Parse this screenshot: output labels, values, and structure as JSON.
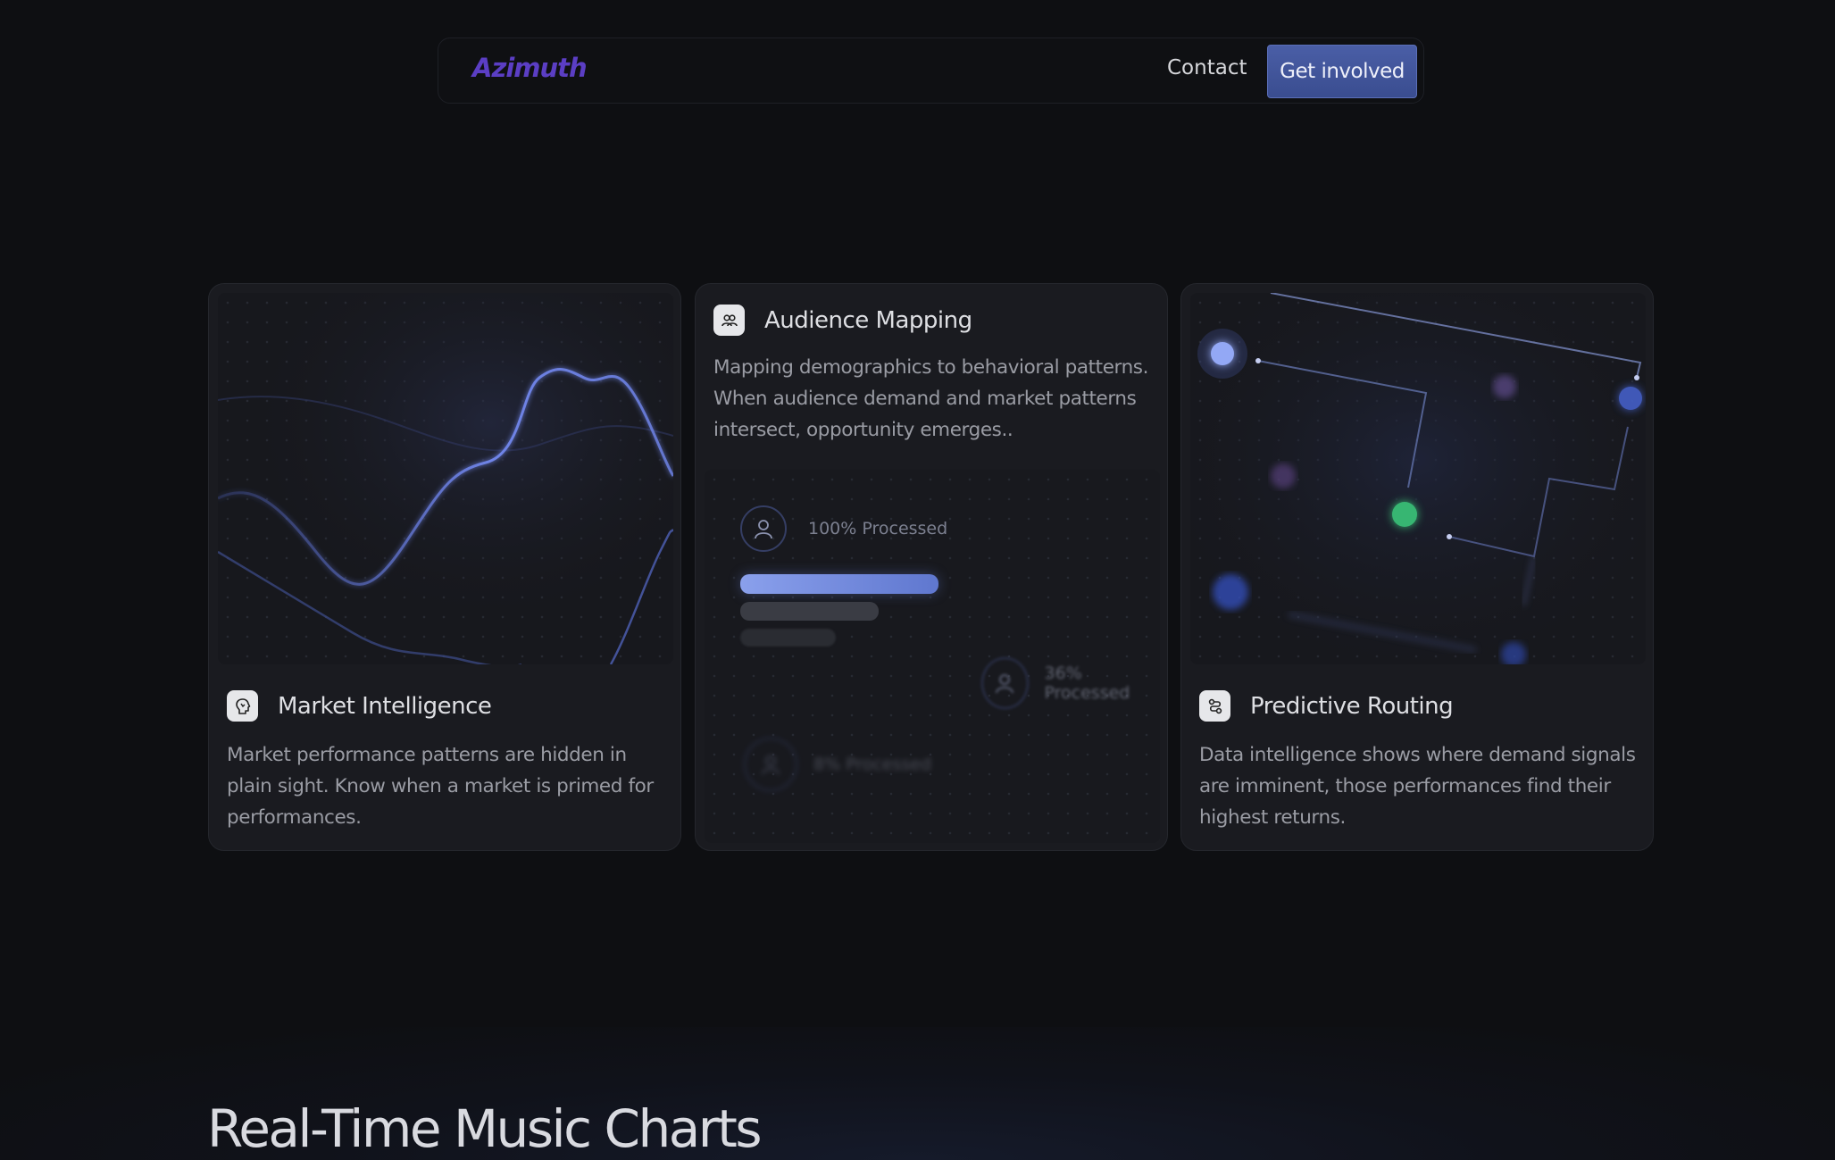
{
  "nav": {
    "logo": "Azimuth",
    "contact_label": "Contact",
    "cta_label": "Get involved"
  },
  "colors": {
    "background": "#0e0f12",
    "card": "#1a1b20",
    "brand": "#5b3ec4",
    "accent": "#4a5ea6",
    "line": "#6f84e8"
  },
  "cards": [
    {
      "icon": "analytics-icon",
      "title": "Market Intelligence",
      "description": "Market performance patterns are hidden in plain sight. Know when a market is primed for performances."
    },
    {
      "icon": "audience-icon",
      "title": "Audience Mapping",
      "description": "Mapping demographics to behavioral patterns. When audience demand and market patterns intersect, opportunity emerges..",
      "processing": [
        {
          "label": "100% Processed",
          "progress": 1.0
        },
        {
          "label": "36% Processed",
          "progress": 0.36
        },
        {
          "label": "8% Processed",
          "progress": 0.08
        }
      ]
    },
    {
      "icon": "routing-icon",
      "title": "Predictive Routing",
      "description": "Data intelligence shows where demand signals are imminent, those performances find their highest returns."
    }
  ],
  "section": {
    "title": "Real-Time Music Charts"
  }
}
